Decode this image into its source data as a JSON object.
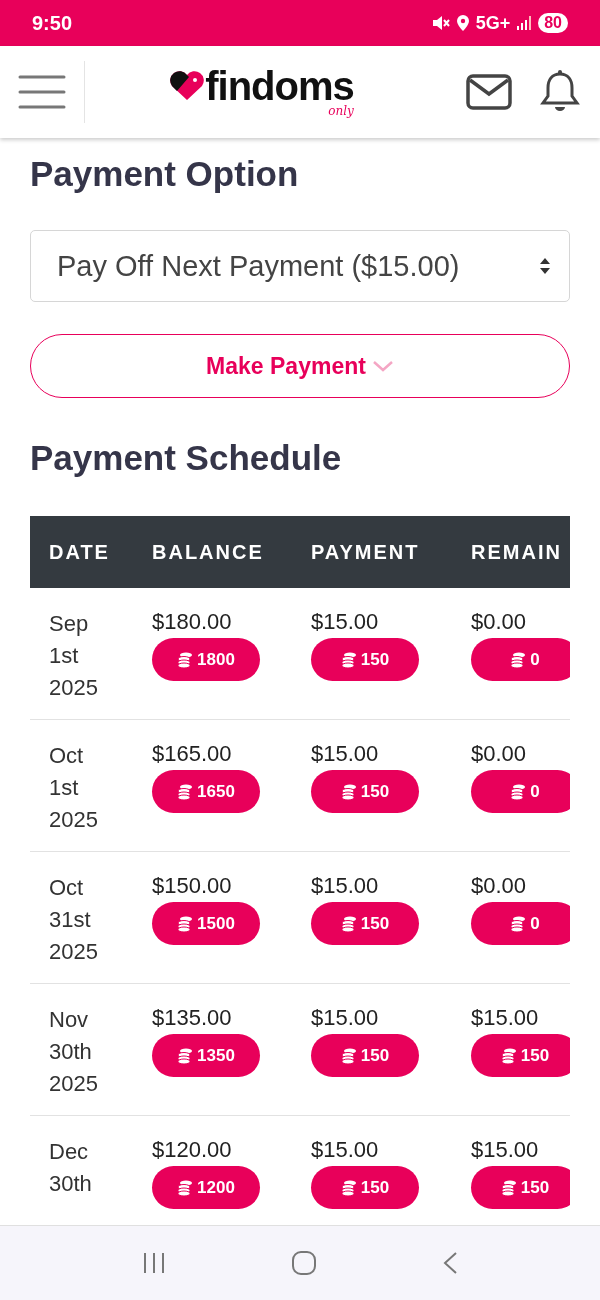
{
  "status_bar": {
    "time": "9:50",
    "network": "5G+",
    "battery": "80"
  },
  "header": {
    "logo": "findoms",
    "logo_tagline": "only"
  },
  "payment_option": {
    "title": "Payment Option",
    "select_value": "Pay Off Next Payment ($15.00)"
  },
  "make_payment": {
    "label": "Make Payment"
  },
  "schedule": {
    "title": "Payment Schedule",
    "columns": [
      "DATE",
      "BALANCE",
      "PAYMENT",
      "REMAIN"
    ],
    "rows": [
      {
        "date": [
          "Sep",
          "1st",
          "2025"
        ],
        "balance": "$180.00",
        "balance_coins": "1800",
        "payment": "$15.00",
        "payment_coins": "150",
        "remaining": "$0.00",
        "remaining_coins": "0"
      },
      {
        "date": [
          "Oct",
          "1st",
          "2025"
        ],
        "balance": "$165.00",
        "balance_coins": "1650",
        "payment": "$15.00",
        "payment_coins": "150",
        "remaining": "$0.00",
        "remaining_coins": "0"
      },
      {
        "date": [
          "Oct",
          "31st",
          "2025"
        ],
        "balance": "$150.00",
        "balance_coins": "1500",
        "payment": "$15.00",
        "payment_coins": "150",
        "remaining": "$0.00",
        "remaining_coins": "0"
      },
      {
        "date": [
          "Nov",
          "30th",
          "2025"
        ],
        "balance": "$135.00",
        "balance_coins": "1350",
        "payment": "$15.00",
        "payment_coins": "150",
        "remaining": "$15.00",
        "remaining_coins": "150"
      },
      {
        "date": [
          "Dec",
          "30th"
        ],
        "balance": "$120.00",
        "balance_coins": "1200",
        "payment": "$15.00",
        "payment_coins": "150",
        "remaining": "$15.00",
        "remaining_coins": "150"
      }
    ]
  }
}
